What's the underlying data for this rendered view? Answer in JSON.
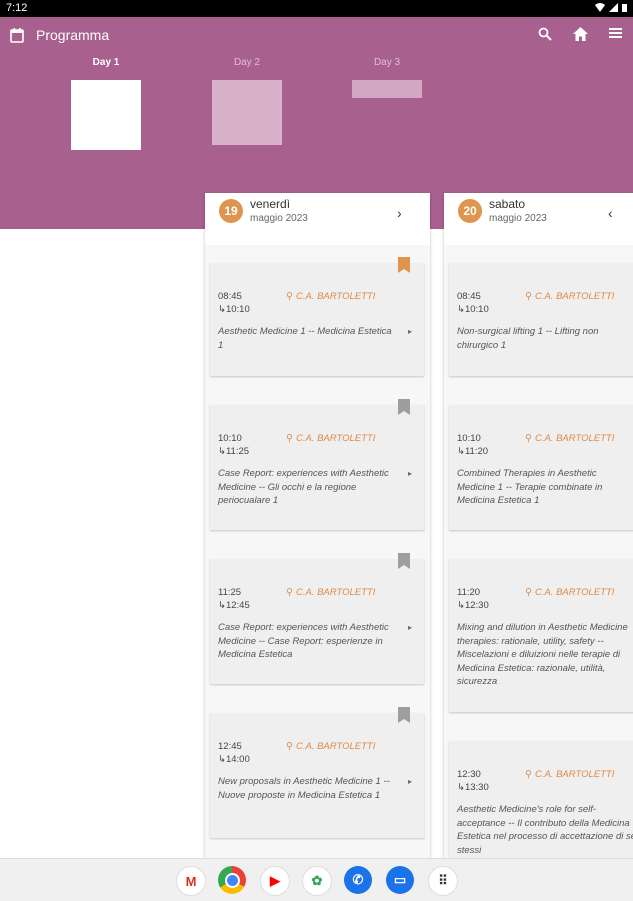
{
  "status": {
    "time": "7:12"
  },
  "header": {
    "title": "Programma"
  },
  "tabs": [
    {
      "label": "Day 1"
    },
    {
      "label": "Day 2"
    },
    {
      "label": "Day 3"
    }
  ],
  "days": [
    {
      "num": "19",
      "name": "venerdì",
      "month": "maggio 2023",
      "nav": "›",
      "events": [
        {
          "start": "08:45",
          "end": "↳10:10",
          "location": "C.A. BARTOLETTI",
          "title": "Aesthetic Medicine 1 -- Medicina Estetica 1",
          "bookmarked": true
        },
        {
          "start": "10:10",
          "end": "↳11:25",
          "location": "C.A. BARTOLETTI",
          "title": "Case Report: experiences with Aesthetic Medicine -- Gli occhi e la regione periocualare 1",
          "bookmarked": false
        },
        {
          "start": "11:25",
          "end": "↳12:45",
          "location": "C.A. BARTOLETTI",
          "title": "Case Report: experiences with Aesthetic Medicine -- Case Report: esperienze in Medicina Estetica",
          "bookmarked": false
        },
        {
          "start": "12:45",
          "end": "↳14:00",
          "location": "C.A. BARTOLETTI",
          "title": "New proposals in Aesthetic Medicine 1 -- Nuove proposte in Medicina Estetica 1",
          "bookmarked": false
        }
      ]
    },
    {
      "num": "20",
      "name": "sabato",
      "month": "maggio 2023",
      "nav": "‹",
      "events": [
        {
          "start": "08:45",
          "end": "↳10:10",
          "location": "C.A. BARTOLETTI",
          "title": "Non-surgical lifting 1 -- Lifting non chirurgico 1",
          "bookmarked": false
        },
        {
          "start": "10:10",
          "end": "↳11:20",
          "location": "C.A. BARTOLETTI",
          "title": "Combined Therapies in Aesthetic Medicine 1 -- Terapie combinate in Medicina Estetica 1",
          "bookmarked": false
        },
        {
          "start": "11:20",
          "end": "↳12:30",
          "location": "C.A. BARTOLETTI",
          "title": "Mixing and dilution in Aesthetic Medicine therapies: rationale, utility, safety -- Miscelazioni e diluizioni nelle terapie di Medicina Estetica: razionale, utilità, sicurezza",
          "bookmarked": false
        },
        {
          "start": "12:30",
          "end": "↳13:30",
          "location": "C.A. BARTOLETTI",
          "title": "Aesthetic Medicine's role for self-acceptance -- Il contributo della Medicina Estetica nel processo di accettazione di se stessi",
          "bookmarked": false
        }
      ]
    }
  ],
  "colors": {
    "header": "#a8608f",
    "accent": "#e0954e",
    "location": "#e08a45"
  },
  "icons": {
    "calendar": "calendar-icon",
    "search": "search-icon",
    "home": "home-icon",
    "menu": "menu-icon",
    "bookmark": "bookmark-icon"
  },
  "nav_apps": [
    {
      "name": "gmail-icon",
      "glyph": "M"
    },
    {
      "name": "chrome-icon",
      "glyph": ""
    },
    {
      "name": "youtube-icon",
      "glyph": "▶"
    },
    {
      "name": "photos-icon",
      "glyph": "✿"
    },
    {
      "name": "phone-icon",
      "glyph": "✆"
    },
    {
      "name": "messages-icon",
      "glyph": "▭"
    },
    {
      "name": "app-drawer-icon",
      "glyph": "⠿"
    }
  ]
}
